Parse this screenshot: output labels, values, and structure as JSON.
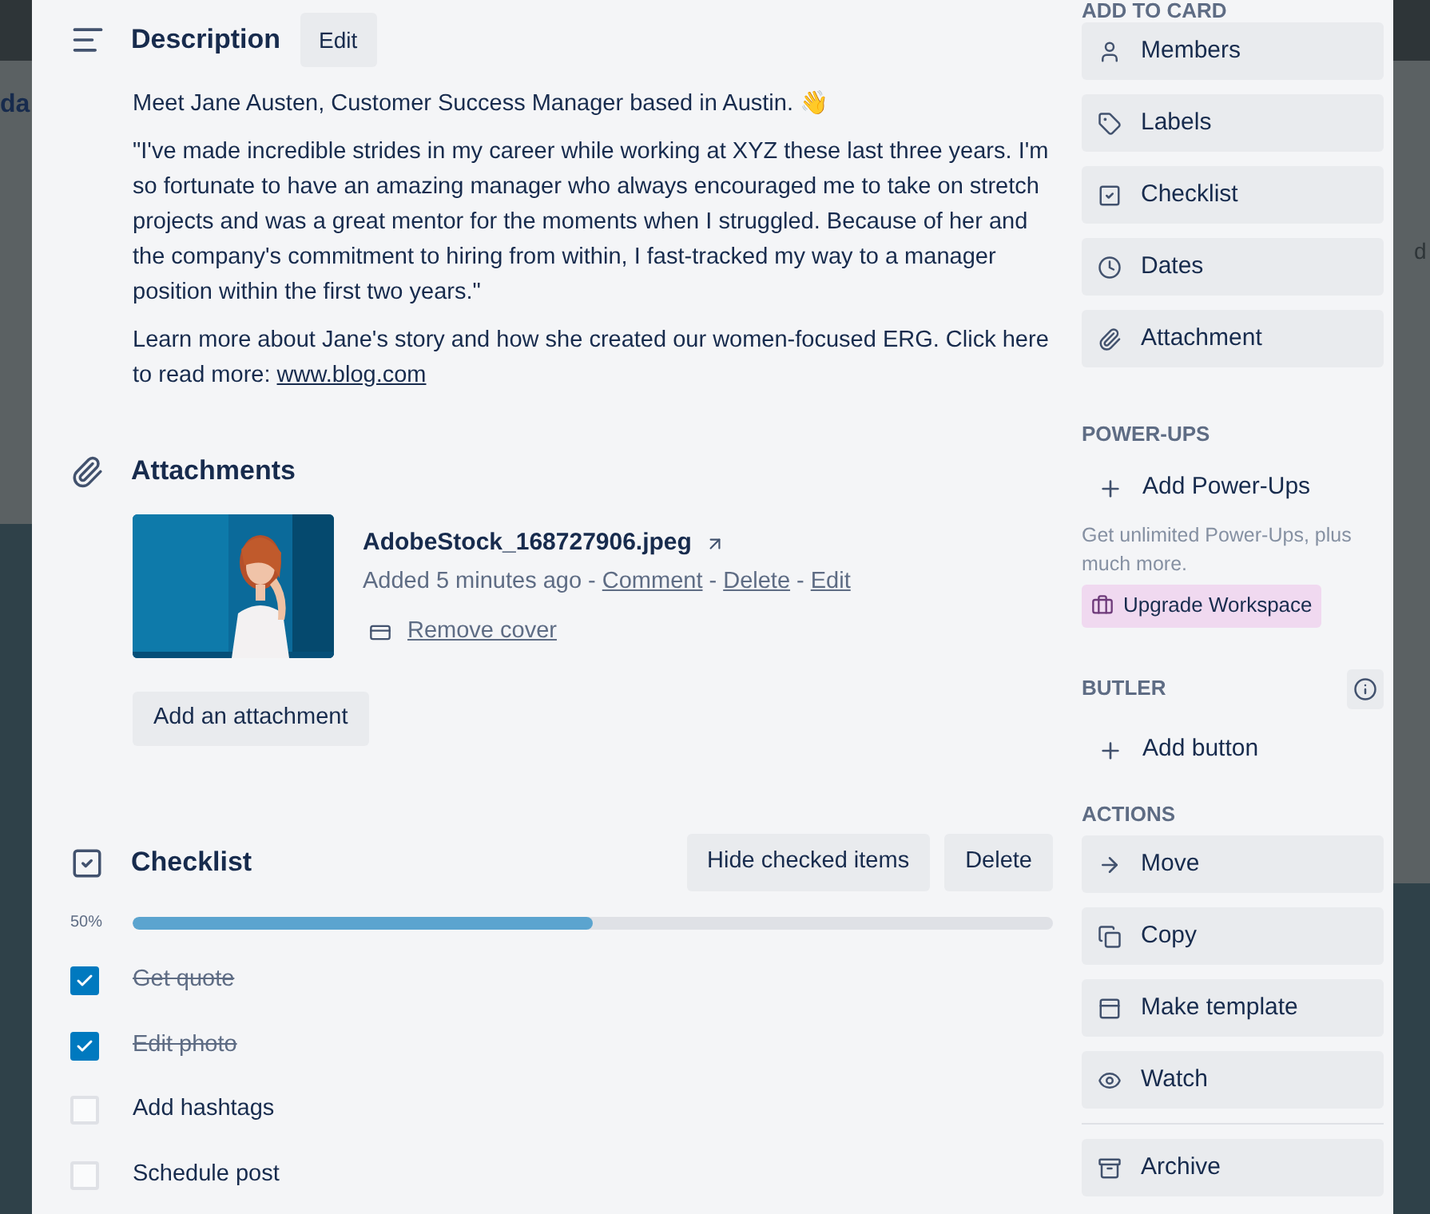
{
  "backdrop": {
    "left_text": "da",
    "right_text": "d"
  },
  "description": {
    "title": "Description",
    "edit_button": "Edit",
    "paragraphs": [
      "Meet Jane Austen, Customer Success Manager based in Austin. 👋",
      "\"I've made incredible strides in my career while working at XYZ these last three years. I'm so fortunate to have an amazing manager who always encouraged me to take on stretch projects and was a great mentor for the moments when I struggled. Because of her and the company's commitment to hiring from within, I fast-tracked my way to a manager position within the first two years.\"",
      "Learn more about Jane's story and how she created our women-focused ERG. Click here to read more: "
    ],
    "link": "www.blog.com"
  },
  "attachments": {
    "title": "Attachments",
    "items": [
      {
        "thumbnail": {
          "kind": "picture"
        },
        "name": "AdobeStock_168727906.jpeg",
        "added": "Added 5 minutes ago",
        "separator": "-",
        "actions": [
          "Comment",
          "Delete",
          "Edit"
        ],
        "cover_action": "Remove cover"
      }
    ],
    "add_button": "Add an attachment"
  },
  "checklist": {
    "title": "Checklist",
    "buttons": [
      "Hide checked items",
      "Delete"
    ],
    "percent": "50%",
    "level": 0.5,
    "items": [
      {
        "label": "Get quote",
        "checked": true
      },
      {
        "label": "Edit photo",
        "checked": true
      },
      {
        "label": "Add hashtags",
        "checked": false
      },
      {
        "label": "Schedule post",
        "checked": false
      }
    ]
  },
  "sidebar": {
    "add_to_card": {
      "title": "ADD TO CARD",
      "items": [
        "Members",
        "Labels",
        "Checklist",
        "Dates",
        "Attachment"
      ]
    },
    "power_ups": {
      "title": "POWER-UPS",
      "add": "Add Power-Ups",
      "note": "Get unlimited Power-Ups, plus much more.",
      "upgrade": "Upgrade Workspace"
    },
    "butler": {
      "title": "BUTLER",
      "add": "Add button"
    },
    "actions": {
      "title": "ACTIONS",
      "items": [
        "Move",
        "Copy",
        "Make template",
        "Watch"
      ],
      "archive": "Archive"
    }
  }
}
